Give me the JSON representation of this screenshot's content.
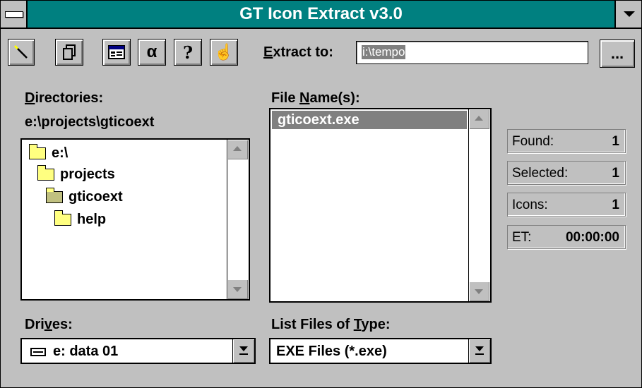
{
  "window": {
    "title": "GT Icon Extract v3.0"
  },
  "toolbar": {
    "buttons": [
      {
        "name": "wand",
        "icon": "wand-icon",
        "glyph": "╲"
      },
      {
        "name": "copy",
        "icon": "copy-icon",
        "glyph": "❐"
      },
      {
        "name": "view",
        "icon": "window-icon",
        "glyph": "▤"
      },
      {
        "name": "alpha",
        "icon": "alpha-icon",
        "glyph": "α"
      },
      {
        "name": "help",
        "icon": "help-icon",
        "glyph": "?"
      },
      {
        "name": "hand",
        "icon": "hand-icon",
        "glyph": "☝"
      }
    ],
    "extract_to_prefix": "E",
    "extract_to_rest": "xtract to:",
    "extract_to_value": "i:\\tempo",
    "browse_label": "..."
  },
  "directories": {
    "label_prefix": "D",
    "label_rest": "irectories:",
    "current_path": "e:\\projects\\gticoext",
    "items": [
      {
        "label": "e:\\",
        "state": "open"
      },
      {
        "label": "projects",
        "state": "open"
      },
      {
        "label": "gticoext",
        "state": "open"
      },
      {
        "label": "help",
        "state": "closed"
      }
    ]
  },
  "files": {
    "label_a": "File ",
    "label_u": "N",
    "label_b": "ame(s):",
    "items": [
      "gticoext.exe"
    ]
  },
  "drives": {
    "label_a": "Dri",
    "label_u": "v",
    "label_b": "es:",
    "value": "e: data 01"
  },
  "filetype": {
    "label_a": "List Files of ",
    "label_u": "T",
    "label_b": "ype:",
    "value": "EXE Files (*.exe)"
  },
  "stats": [
    {
      "key": "Found:",
      "value": "1"
    },
    {
      "key": "Selected:",
      "value": "1"
    },
    {
      "key": "Icons:",
      "value": "1"
    },
    {
      "key": "ET:",
      "value": "00:00:00"
    }
  ]
}
